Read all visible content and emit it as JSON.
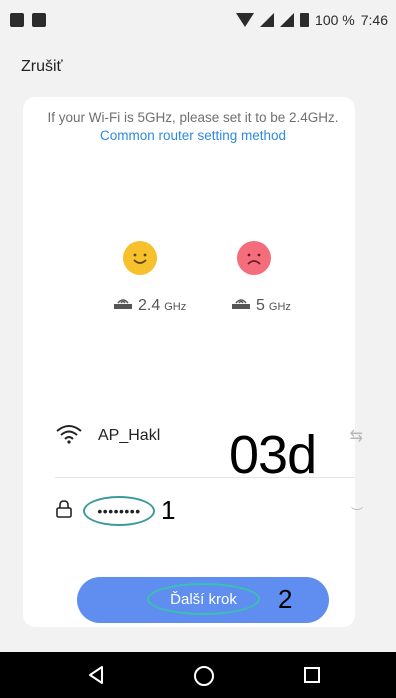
{
  "status_bar": {
    "battery_percent": "100 %",
    "time": "7:46",
    "icons": [
      "notification-image-icon",
      "gallery-icon",
      "wifi-icon",
      "signal-icon",
      "signal-icon",
      "battery-icon"
    ]
  },
  "header": {
    "cancel_label": "Zrušiť"
  },
  "info": {
    "text": "If your Wi-Fi is 5GHz, please set it to be 2.4GHz.",
    "link_text": "Common router setting method"
  },
  "bands": [
    {
      "num": "2.4",
      "unit": "GHz",
      "status": "supported"
    },
    {
      "num": "5",
      "unit": "GHz",
      "status": "unsupported"
    }
  ],
  "network": {
    "ssid": "AP_Hakl",
    "password_masked": "••••••••"
  },
  "annotations": {
    "code": "03d",
    "marker_1": "1",
    "marker_2": "2"
  },
  "next_button": {
    "label": "Ďalší krok"
  },
  "colors": {
    "accent": "#5f8ef0",
    "link": "#2d8ae0",
    "happy_face": "#f7c12d",
    "sad_face": "#f46d7a",
    "annotation_circle": "#3d9a9a"
  }
}
